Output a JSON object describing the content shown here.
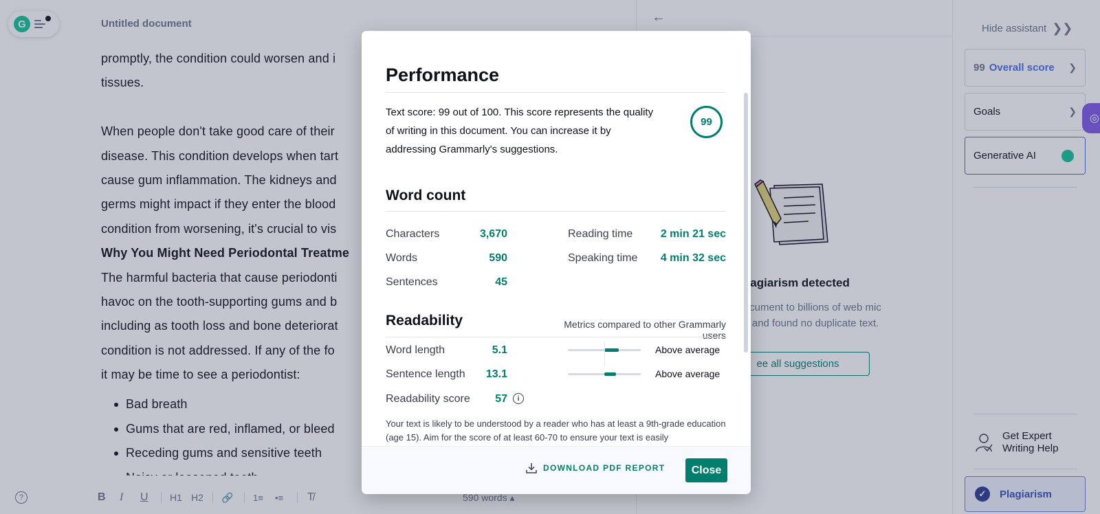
{
  "editor": {
    "title": "Untitled document",
    "lines_top": [
      "promptly, the condition could worsen and i",
      "tissues."
    ],
    "lines_para": [
      "When people don't take good care of their",
      "disease. This condition develops when tart",
      "cause gum inflammation. The kidneys and",
      "germs might impact if they enter the blood",
      "condition from worsening, it's crucial to vis"
    ],
    "heading": "Why You Might Need Periodontal Treatme",
    "lines_para2": [
      "The harmful bacteria that cause periodonti",
      "havoc on the tooth-supporting gums and b",
      "including as tooth loss and bone deteriorat",
      "condition is not addressed. If any of the fo",
      "it may be time to see a periodontist:"
    ],
    "bullets": [
      "Bad breath",
      "Gums that are red, inflamed, or bleed",
      "Receding gums and sensitive teeth",
      "Noisy or loosened teeth"
    ],
    "word_count": "590 words ▴",
    "toolbar": {
      "help": "?",
      "bold": "B",
      "italic": "I",
      "underline": "U",
      "h1": "H1",
      "h2": "H2",
      "link": "🔗",
      "ordered_list": "1≡",
      "bullet_list": "•≡",
      "clear_format": "T̸"
    }
  },
  "middle_panel": {
    "back_icon": "←",
    "plagiarism_title": "plagiarism detected",
    "plagiarism_text": "your document to billions of web mic papers and found no duplicate text.",
    "see_all_label": "ee all suggestions"
  },
  "sidebar": {
    "hide_assistant": "Hide assistant",
    "overall_score": "99",
    "overall_score_label": "Overall score",
    "goals": "Goals",
    "generative_ai": "Generative AI",
    "expert_help": "Get Expert\nWriting Help",
    "plagiarism": "Plagiarism"
  },
  "modal": {
    "performance_title": "Performance",
    "score_text": "Text score: 99 out of 100. This score represents the quality of writing in this document. You can increase it by addressing Grammarly's suggestions.",
    "score_value": "99",
    "word_count_title": "Word count",
    "word_count": {
      "characters_label": "Characters",
      "characters": "3,670",
      "words_label": "Words",
      "words": "590",
      "sentences_label": "Sentences",
      "sentences": "45",
      "reading_time_label": "Reading time",
      "reading_time": "2 min 21 sec",
      "speaking_time_label": "Speaking time",
      "speaking_time": "4 min 32 sec"
    },
    "readability_title": "Readability",
    "metrics_note": "Metrics compared to other Grammarly users",
    "readability": {
      "word_length_label": "Word length",
      "word_length": "5.1",
      "word_length_rating": "Above average",
      "word_length_level": 0.7,
      "sentence_length_label": "Sentence length",
      "sentence_length": "13.1",
      "sentence_length_rating": "Above average",
      "sentence_length_level": 0.66,
      "score_label": "Readability score",
      "score": "57"
    },
    "readability_explain": "Your text is likely to be understood by a reader who has at least a 9th-grade education (age 15). Aim for the score of at least 60-70 to ensure your text is easily",
    "download_label": "DOWNLOAD PDF REPORT",
    "close_label": "Close"
  },
  "colors": {
    "accent": "#027e6f",
    "brand_green": "#15c39a",
    "plagiarism_blue": "#3351b5"
  }
}
